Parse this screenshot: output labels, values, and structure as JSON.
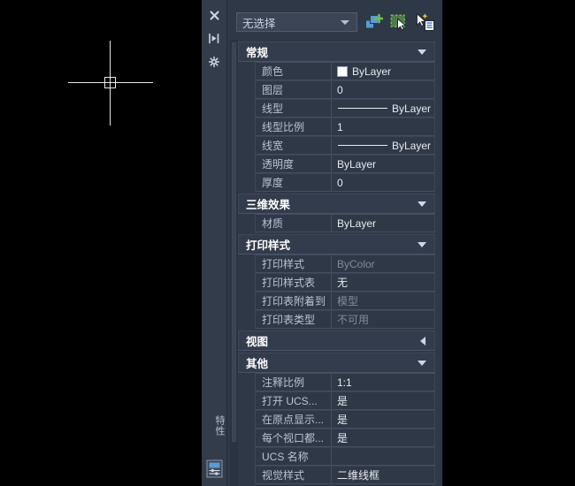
{
  "window": {
    "palette_title": "特性",
    "selector_value": "无选择",
    "strip_icons": [
      {
        "name": "close-icon",
        "label": "关闭"
      },
      {
        "name": "auto-hide-icon",
        "label": "自动隐藏"
      },
      {
        "name": "panel-options-icon",
        "label": "特性选项"
      }
    ],
    "toolbar_icons": [
      {
        "name": "toggle-pickadd-icon",
        "label": "切换 PICKADD 系统变量值"
      },
      {
        "name": "select-objects-icon",
        "label": "选择对象"
      },
      {
        "name": "quick-select-icon",
        "label": "快速选择"
      }
    ],
    "bottom_icon": "properties-panel-icon"
  },
  "colors": {
    "palette_bg": "#2f3847",
    "section_bg": "#333c4c",
    "strip_bg": "#333c4b",
    "text": "#e7ebf1",
    "label": "#b9c3d1",
    "dim_text": "#818b9b",
    "canvas_bg": "#000000",
    "crosshair": "#e8e8e8",
    "accent_green": "#6fbf5a",
    "accent_blue": "#5b9bd5"
  },
  "sections": [
    {
      "name": "general",
      "title": "常规",
      "collapsed": false,
      "rows": [
        {
          "label": "颜色",
          "value": "ByLayer",
          "kind": "color-swatch",
          "dim": false
        },
        {
          "label": "图层",
          "value": "0",
          "kind": "text",
          "dim": false
        },
        {
          "label": "线型",
          "value": "ByLayer",
          "kind": "line-swatch",
          "dim": false
        },
        {
          "label": "线型比例",
          "value": "1",
          "kind": "text",
          "dim": false
        },
        {
          "label": "线宽",
          "value": "ByLayer",
          "kind": "line-swatch",
          "dim": false
        },
        {
          "label": "透明度",
          "value": "ByLayer",
          "kind": "text",
          "dim": false
        },
        {
          "label": "厚度",
          "value": "0",
          "kind": "text",
          "dim": false
        }
      ]
    },
    {
      "name": "three-d-effects",
      "title": "三维效果",
      "collapsed": false,
      "rows": [
        {
          "label": "材质",
          "value": "ByLayer",
          "kind": "text",
          "dim": false
        }
      ]
    },
    {
      "name": "plot-style",
      "title": "打印样式",
      "collapsed": false,
      "rows": [
        {
          "label": "打印样式",
          "value": "ByColor",
          "kind": "text",
          "dim": true
        },
        {
          "label": "打印样式表",
          "value": "无",
          "kind": "text",
          "dim": false
        },
        {
          "label": "打印表附着到",
          "value": "模型",
          "kind": "text",
          "dim": true
        },
        {
          "label": "打印表类型",
          "value": "不可用",
          "kind": "text",
          "dim": true
        }
      ]
    },
    {
      "name": "view",
      "title": "视图",
      "collapsed": true,
      "rows": []
    },
    {
      "name": "misc",
      "title": "其他",
      "collapsed": false,
      "rows": [
        {
          "label": "注释比例",
          "value": "1:1",
          "kind": "text",
          "dim": false
        },
        {
          "label": "打开 UCS...",
          "value": "是",
          "kind": "text",
          "dim": false
        },
        {
          "label": "在原点显示...",
          "value": "是",
          "kind": "text",
          "dim": false
        },
        {
          "label": "每个视口都...",
          "value": "是",
          "kind": "text",
          "dim": false
        },
        {
          "label": "UCS 名称",
          "value": "",
          "kind": "text",
          "dim": false
        },
        {
          "label": "视觉样式",
          "value": "二维线框",
          "kind": "text",
          "dim": false
        }
      ]
    }
  ]
}
